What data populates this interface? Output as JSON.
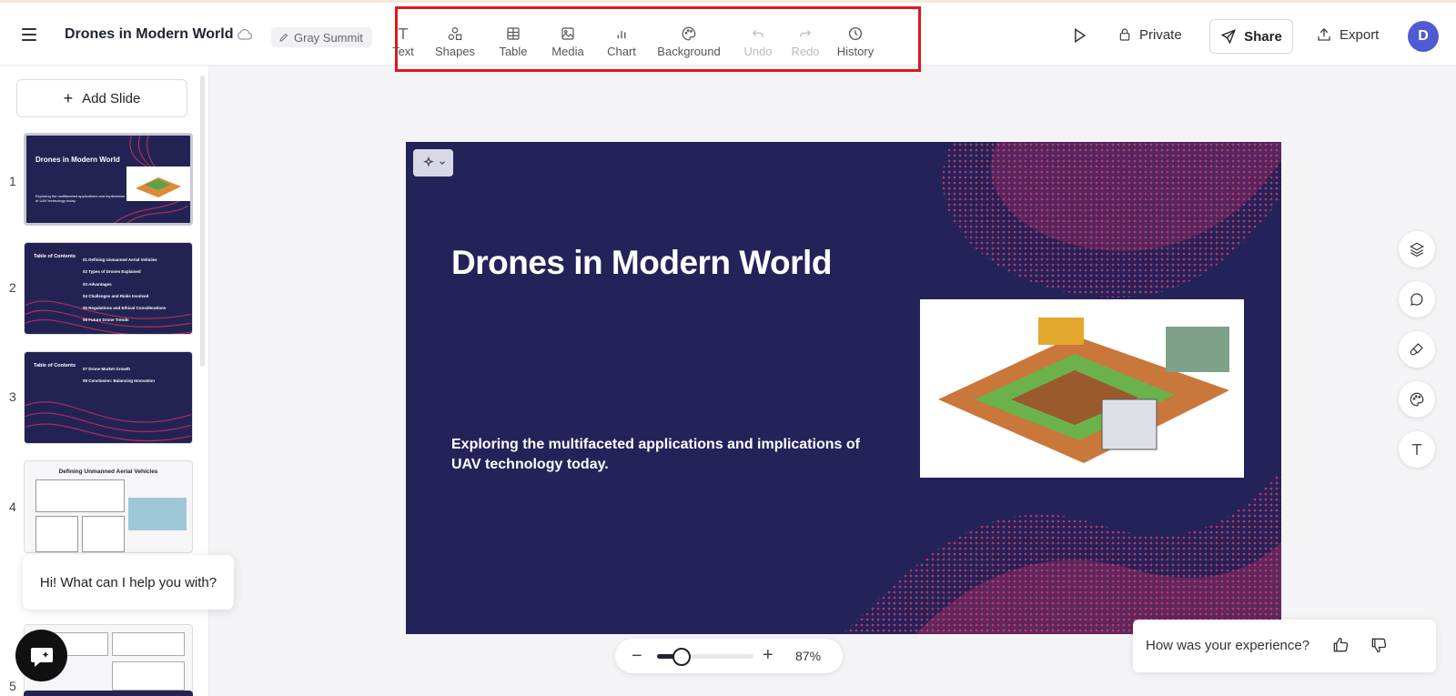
{
  "header": {
    "doc_title": "Drones in Modern World",
    "theme_name": "Gray Summit",
    "tools": [
      {
        "label": "Text",
        "icon": "text-icon",
        "enabled": true
      },
      {
        "label": "Shapes",
        "icon": "shapes-icon",
        "enabled": true
      },
      {
        "label": "Table",
        "icon": "table-icon",
        "enabled": true
      },
      {
        "label": "Media",
        "icon": "media-icon",
        "enabled": true
      },
      {
        "label": "Chart",
        "icon": "chart-icon",
        "enabled": true
      },
      {
        "label": "Background",
        "icon": "palette-icon",
        "enabled": true
      },
      {
        "label": "Undo",
        "icon": "undo-icon",
        "enabled": false
      },
      {
        "label": "Redo",
        "icon": "redo-icon",
        "enabled": false
      },
      {
        "label": "History",
        "icon": "clock-icon",
        "enabled": true
      }
    ],
    "private_label": "Private",
    "share_label": "Share",
    "export_label": "Export",
    "avatar_initial": "D"
  },
  "sidebar": {
    "add_slide_label": "Add Slide",
    "slides": [
      {
        "num": "1",
        "title": "Drones in Modern World",
        "subtitle": "Exploring the multifaceted applications and implications of UAV technology today."
      },
      {
        "num": "2",
        "title": "Table of Contents",
        "items": [
          "01  Defining Unmanned Aerial Vehicles",
          "02  Types of Drones Explained",
          "03  Advantages",
          "04  Challenges and Risks Involved",
          "05  Regulations and Ethical Considerations",
          "06  Future Drone Trends"
        ]
      },
      {
        "num": "3",
        "title": "Table of Contents",
        "items": [
          "07  Drone Market Growth",
          "08  Conclusion: Balancing Innovation"
        ]
      },
      {
        "num": "4",
        "title": "Defining Unmanned Aerial Vehicles"
      },
      {
        "num": "5"
      }
    ]
  },
  "chat": {
    "greeting": "Hi! What can I help you with?"
  },
  "slide": {
    "title": "Drones in Modern World",
    "subtitle": "Exploring the multifaceted applications and implications of UAV technology today."
  },
  "zoom": {
    "percent_label": "87%",
    "level": 0.25
  },
  "feedback": {
    "question": "How was your experience?"
  },
  "colors": {
    "slide_bg": "#23235a",
    "wave_pink": "#e0356a",
    "accent": "#4f5bd5",
    "toolbar_highlight": "#e0161f"
  }
}
